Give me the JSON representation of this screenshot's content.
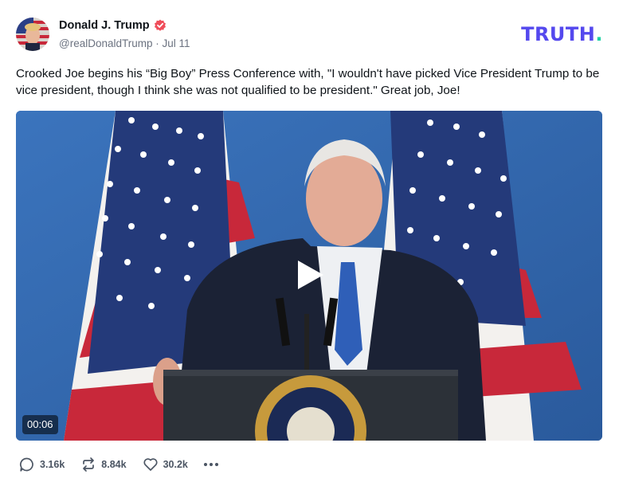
{
  "post": {
    "author_name": "Donald J. Trump",
    "handle": "@realDonaldTrump",
    "separator": "·",
    "date": "Jul 11",
    "text": "Crooked Joe begins his “Big Boy” Press Conference with, \"I wouldn't have picked Vice President Trump to be vice president, though I think she was not qualified to be president.\" Great job, Joe!"
  },
  "brand": {
    "name": "TRUTH",
    "dot": ".",
    "color": "#5448ee",
    "dot_color": "#1fd1a5"
  },
  "video": {
    "duration": "00:06",
    "icon": "play-icon"
  },
  "actions": {
    "replies": {
      "icon": "reply-icon",
      "count": "3.16k"
    },
    "retruths": {
      "icon": "retruth-icon",
      "count": "8.84k"
    },
    "likes": {
      "icon": "heart-icon",
      "count": "30.2k"
    },
    "more": {
      "icon": "more-icon"
    }
  },
  "colors": {
    "verified": "#ef4d5a",
    "text": "#0f1419",
    "muted": "#6b7280"
  }
}
